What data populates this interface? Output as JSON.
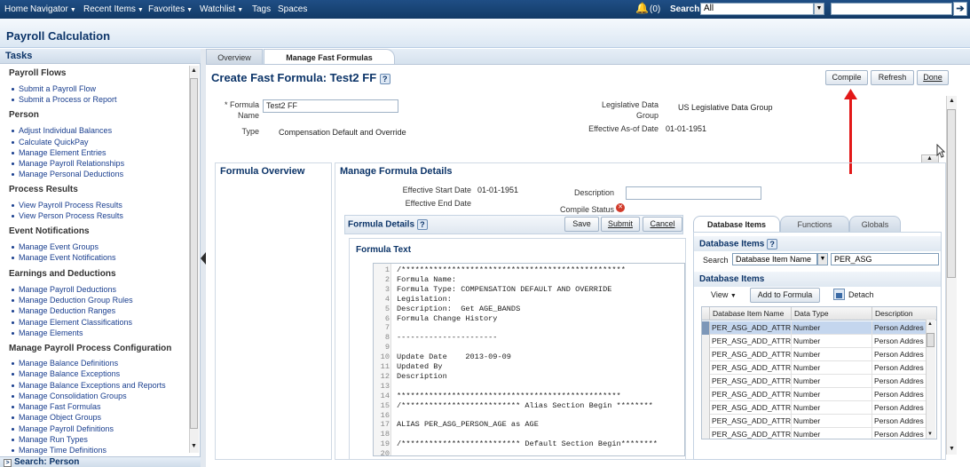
{
  "topbar": {
    "nav": [
      {
        "label": "Home",
        "caret": false
      },
      {
        "label": "Navigator",
        "caret": true
      },
      {
        "label": "Recent Items",
        "caret": true
      },
      {
        "label": "Favorites",
        "caret": true
      },
      {
        "label": "Watchlist",
        "caret": true
      },
      {
        "label": "Tags",
        "caret": false
      },
      {
        "label": "Spaces",
        "caret": false
      }
    ],
    "notifications_count": "(0)",
    "search_label": "Search",
    "search_scope": "All",
    "search_value": ""
  },
  "app_title": "Payroll Calculation",
  "tasks": {
    "header": "Tasks",
    "sections": [
      {
        "title": "Payroll Flows",
        "items": [
          "Submit a Payroll Flow",
          "Submit a Process or Report"
        ]
      },
      {
        "title": "Person",
        "items": [
          "Adjust Individual Balances",
          "Calculate QuickPay",
          "Manage Element Entries",
          "Manage Payroll Relationships",
          "Manage Personal Deductions"
        ]
      },
      {
        "title": "Process Results",
        "items": [
          "View Payroll Process Results",
          "View Person Process Results"
        ]
      },
      {
        "title": "Event Notifications",
        "items": [
          "Manage Event Groups",
          "Manage Event Notifications"
        ]
      },
      {
        "title": "Earnings and Deductions",
        "items": [
          "Manage Payroll Deductions",
          "Manage Deduction Group Rules",
          "Manage Deduction Ranges",
          "Manage Element Classifications",
          "Manage Elements"
        ]
      },
      {
        "title": "Manage Payroll Process Configuration",
        "items": [
          "Manage Balance Definitions",
          "Manage Balance Exceptions",
          "Manage Balance Exceptions and Reports",
          "Manage Consolidation Groups",
          "Manage Fast Formulas",
          "Manage Object Groups",
          "Manage Payroll Definitions",
          "Manage Run Types",
          "Manage Time Definitions"
        ]
      }
    ],
    "search_person": "Search: Person"
  },
  "tabs": [
    "Overview",
    "Manage Fast Formulas"
  ],
  "page": {
    "title": "Create Fast Formula: Test2 FF",
    "help": "?",
    "buttons": {
      "compile": "Compile",
      "refresh": "Refresh",
      "done": "Done"
    },
    "formula_name_label": "* Formula Name",
    "formula_name_value": "Test2 FF",
    "type_label": "Type",
    "type_value": "Compensation Default and Override",
    "legislative_label": "Legislative Data Group",
    "legislative_value": "US Legislative Data Group",
    "effective_asof_label": "Effective As-of Date",
    "effective_asof_value": "01-01-1951"
  },
  "formula_overview": {
    "header": "Formula Overview"
  },
  "manage_details": {
    "header": "Manage Formula Details",
    "eff_start_label": "Effective Start Date",
    "eff_start_value": "01-01-1951",
    "eff_end_label": "Effective End Date",
    "description_label": "Description",
    "description_value": "",
    "compile_status_label": "Compile Status"
  },
  "formula_details": {
    "header": "Formula Details",
    "help": "?",
    "buttons": {
      "save": "Save",
      "submit": "Submit",
      "cancel": "Cancel"
    },
    "text_header": "Formula Text",
    "lines": [
      {
        "n": "1",
        "t": "/*************************************************"
      },
      {
        "n": "2",
        "t": "Formula Name:"
      },
      {
        "n": "3",
        "t": "Formula Type: COMPENSATION DEFAULT AND OVERRIDE"
      },
      {
        "n": "4",
        "t": "Legislation:"
      },
      {
        "n": "5",
        "t": "Description:  Get AGE_BANDS"
      },
      {
        "n": "6",
        "t": "Formula Change History"
      },
      {
        "n": "7",
        "t": ""
      },
      {
        "n": "8",
        "t": "----------------------"
      },
      {
        "n": "9",
        "t": ""
      },
      {
        "n": "10",
        "t": "Update Date    2013-09-09"
      },
      {
        "n": "11",
        "t": "Updated By"
      },
      {
        "n": "12",
        "t": "Description"
      },
      {
        "n": "13",
        "t": ""
      },
      {
        "n": "14",
        "t": "*************************************************"
      },
      {
        "n": "15",
        "t": "/************************** Alias Section Begin ********"
      },
      {
        "n": "16",
        "t": ""
      },
      {
        "n": "17",
        "t": "ALIAS PER_ASG_PERSON_AGE as AGE"
      },
      {
        "n": "18",
        "t": ""
      },
      {
        "n": "19",
        "t": "/************************** Default Section Begin********"
      },
      {
        "n": "20",
        "t": ""
      }
    ]
  },
  "right_tabs": [
    "Database Items",
    "Functions",
    "Globals"
  ],
  "database_items": {
    "header": "Database Items",
    "help": "?",
    "search_label": "Search",
    "search_field": "Database Item Name",
    "search_value": "PER_ASG",
    "list_header": "Database Items",
    "view_label": "View",
    "add_button": "Add to Formula",
    "detach_button": "Detach",
    "columns": [
      "Database Item Name",
      "Data Type",
      "Description"
    ],
    "rows": [
      [
        "PER_ASG_ADD_ATTR",
        "Number",
        "Person Addres"
      ],
      [
        "PER_ASG_ADD_ATTR",
        "Number",
        "Person Addres"
      ],
      [
        "PER_ASG_ADD_ATTR",
        "Number",
        "Person Addres"
      ],
      [
        "PER_ASG_ADD_ATTR",
        "Number",
        "Person Addres"
      ],
      [
        "PER_ASG_ADD_ATTR",
        "Number",
        "Person Addres"
      ],
      [
        "PER_ASG_ADD_ATTR",
        "Number",
        "Person Addres"
      ],
      [
        "PER_ASG_ADD_ATTR",
        "Number",
        "Person Addres"
      ],
      [
        "PER_ASG_ADD_ATTR",
        "Number",
        "Person Addres"
      ],
      [
        "PER_ASG_ADD_ATTR",
        "Number",
        "Person Addres"
      ]
    ]
  },
  "colors": {
    "accent": "#0d3569",
    "annotation_arrow": "#e31818",
    "topbar": "#1f4e85"
  }
}
